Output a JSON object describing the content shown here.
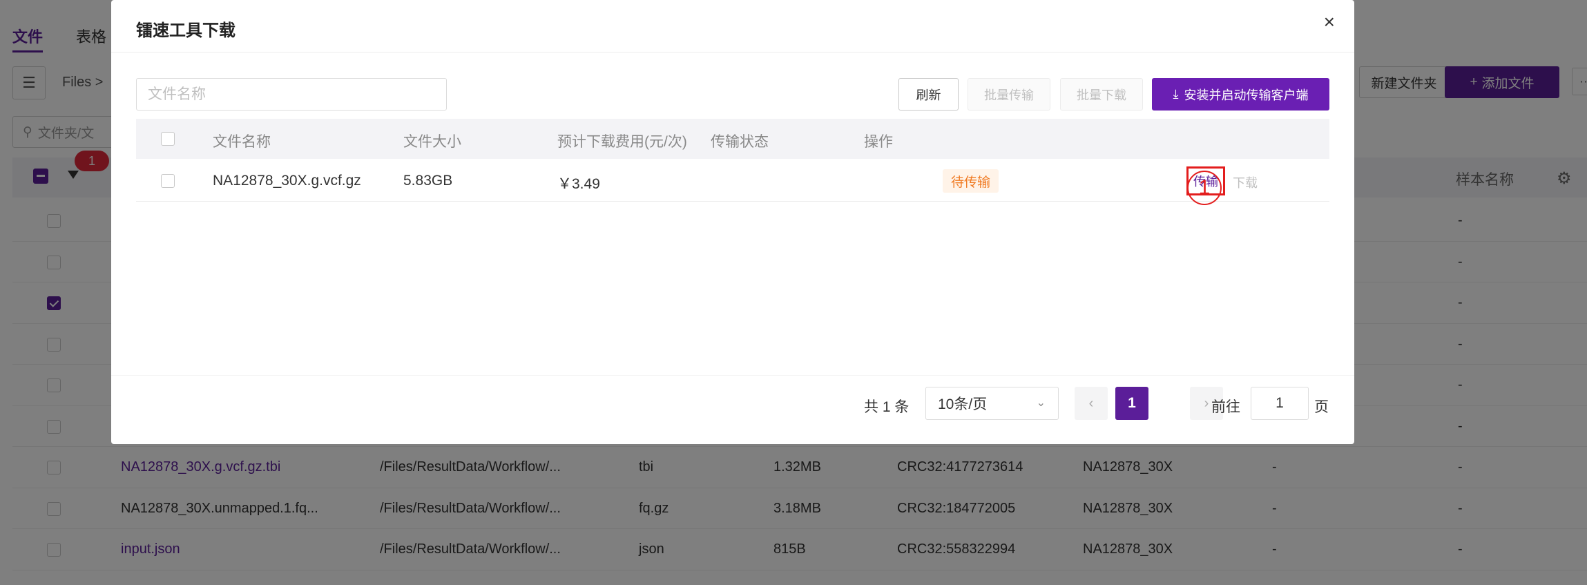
{
  "background": {
    "tabs": [
      {
        "label": "文件",
        "active": true
      },
      {
        "label": "表格",
        "active": false
      }
    ],
    "breadcrumb": "Files >",
    "new_folder_label": "新建文件夹",
    "add_file_label": "添加文件",
    "search_placeholder": "文件夹/文",
    "selected_count": "1",
    "sample_column": "样本名称",
    "rows": [
      {
        "name": "",
        "path": "",
        "ext": "",
        "size": "",
        "crc": "",
        "sample": "",
        "d1": "",
        "d2": "-",
        "checked": false,
        "link": true
      },
      {
        "name": "",
        "path": "",
        "ext": "",
        "size": "",
        "crc": "",
        "sample": "",
        "d1": "",
        "d2": "-",
        "checked": false,
        "link": true
      },
      {
        "name": "",
        "path": "",
        "ext": "",
        "size": "",
        "crc": "",
        "sample": "",
        "d1": "",
        "d2": "-",
        "checked": true,
        "link": true
      },
      {
        "name": "",
        "path": "",
        "ext": "",
        "size": "",
        "crc": "",
        "sample": "",
        "d1": "",
        "d2": "-",
        "checked": false,
        "link": true
      },
      {
        "name": "",
        "path": "",
        "ext": "",
        "size": "",
        "crc": "",
        "sample": "",
        "d1": "",
        "d2": "-",
        "checked": false,
        "link": true
      },
      {
        "name": "",
        "path": "",
        "ext": "",
        "size": "",
        "crc": "",
        "sample": "",
        "d1": "",
        "d2": "-",
        "checked": false,
        "link": true
      },
      {
        "name": "NA12878_30X.g.vcf.gz.tbi",
        "path": "/Files/ResultData/Workflow/...",
        "ext": "tbi",
        "size": "1.32MB",
        "crc": "CRC32:4177273614",
        "sample": "NA12878_30X",
        "d1": "-",
        "d2": "-",
        "checked": false,
        "link": true
      },
      {
        "name": "NA12878_30X.unmapped.1.fq...",
        "path": "/Files/ResultData/Workflow/...",
        "ext": "fq.gz",
        "size": "3.18MB",
        "crc": "CRC32:184772005",
        "sample": "NA12878_30X",
        "d1": "-",
        "d2": "-",
        "checked": false,
        "link": false
      },
      {
        "name": "input.json",
        "path": "/Files/ResultData/Workflow/...",
        "ext": "json",
        "size": "815B",
        "crc": "CRC32:558322994",
        "sample": "NA12878_30X",
        "d1": "-",
        "d2": "-",
        "checked": false,
        "link": true
      }
    ]
  },
  "modal": {
    "title": "镭速工具下载",
    "close_icon": "×",
    "search_placeholder": "文件名称",
    "buttons": {
      "refresh": "刷新",
      "batch_transfer": "批量传输",
      "batch_download": "批量下载",
      "install": "安装并启动传输客户端"
    },
    "columns": [
      "文件名称",
      "文件大小",
      "预计下载费用(元/次)",
      "传输状态",
      "操作"
    ],
    "row": {
      "name": "NA12878_30X.g.vcf.gz",
      "size": "5.83GB",
      "fee": "￥3.49",
      "status": "待传输",
      "transfer": "传输",
      "download": "下载"
    },
    "annotation": "1",
    "pagination": {
      "total": "共 1 条",
      "page_size": "10条/页",
      "current": "1",
      "goto_label": "前往",
      "goto_value": "1",
      "goto_unit": "页"
    }
  },
  "colors": {
    "brand": "#5b1e99",
    "install": "#6a1fb3",
    "highlight": "#e31d1d",
    "status_text": "#f07a22",
    "status_bg": "#fff3e8"
  }
}
